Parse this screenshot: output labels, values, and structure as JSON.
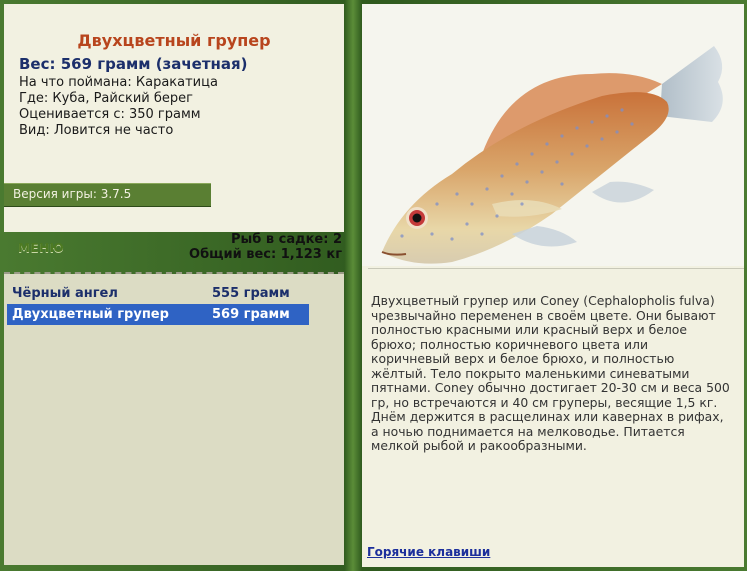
{
  "fish": {
    "title": "Двухцветный групер",
    "weight_line": "Вес: 569 грамм (зачетная)",
    "caught_on": "На что поймана: Каракатица",
    "where": "Где: Куба, Райский берег",
    "valued_from": "Оценивается с: 350 грамм",
    "kind": "Вид: Ловится не часто",
    "description": "Двухцветный групер или Coney (Cephalopholis fulva) чрезвычайно переменен в своём цвете. Они бывают полностью красными или красный верх и белое брюхо; полностью коричневого цвета или коричневый верх и белое брюхо, и полностью жёлтый. Тело покрыто маленькими синеватыми пятнами. Coney обычно достигает 20-30 см и веса 500 гр, но встречаются и 40 см груперы, весящие 1,5 кг. Днём держится в расщелинах или кавернах в рифах, а ночью поднимается на мелководье. Питается мелкой рыбой и ракообразными."
  },
  "version": "Версия игры: 3.7.5",
  "menu_label": "МЕНЮ",
  "stats": {
    "fish_in_keepnet": "Рыб в садке: 2",
    "total_weight": "Общий вес: 1,123 кг"
  },
  "catch_list": [
    {
      "name": "Чёрный ангел",
      "weight": "555 грамм",
      "selected": false
    },
    {
      "name": "Двухцветный групер",
      "weight": "569 грамм",
      "selected": true
    }
  ],
  "hotkeys_label": "Горячие клавиши",
  "colors": {
    "title": "#b8451d",
    "frame": "#3e6b2a",
    "selection": "#2f63c4"
  }
}
